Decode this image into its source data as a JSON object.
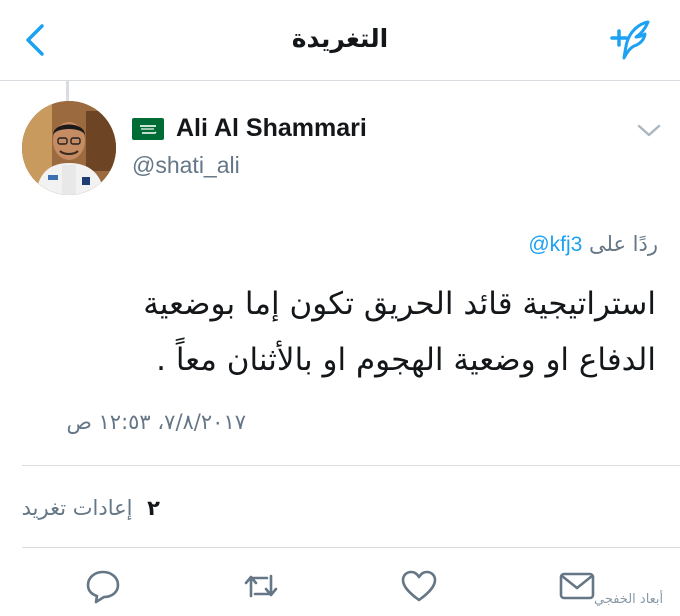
{
  "header": {
    "title": "التغريدة",
    "back_icon": "chevron-left-icon",
    "compose_icon": "compose-tweet-icon",
    "accent_color": "#1da1f2"
  },
  "tweet": {
    "author": {
      "display_name": "Ali Al Shammari",
      "handle": "@shati_ali",
      "flag_icon": "saudi-flag-icon"
    },
    "reply_to": {
      "prefix": "ردًا على",
      "mention": "@kfj3"
    },
    "text_lines": [
      "استراتيجية قائد الحريق تكون إما بوضعية",
      "الدفاع او وضعية الهجوم او بالأثنان معاً ."
    ],
    "timestamp": "٧/٨/٢٠١٧، ١٢:٥٣ ص",
    "retweets": {
      "count": "٢",
      "label": "إعادات تغريد"
    }
  },
  "actions": [
    {
      "name": "reply-icon"
    },
    {
      "name": "retweet-icon"
    },
    {
      "name": "like-icon"
    },
    {
      "name": "direct-message-icon"
    }
  ],
  "watermark": "أبعاد الخفجي"
}
